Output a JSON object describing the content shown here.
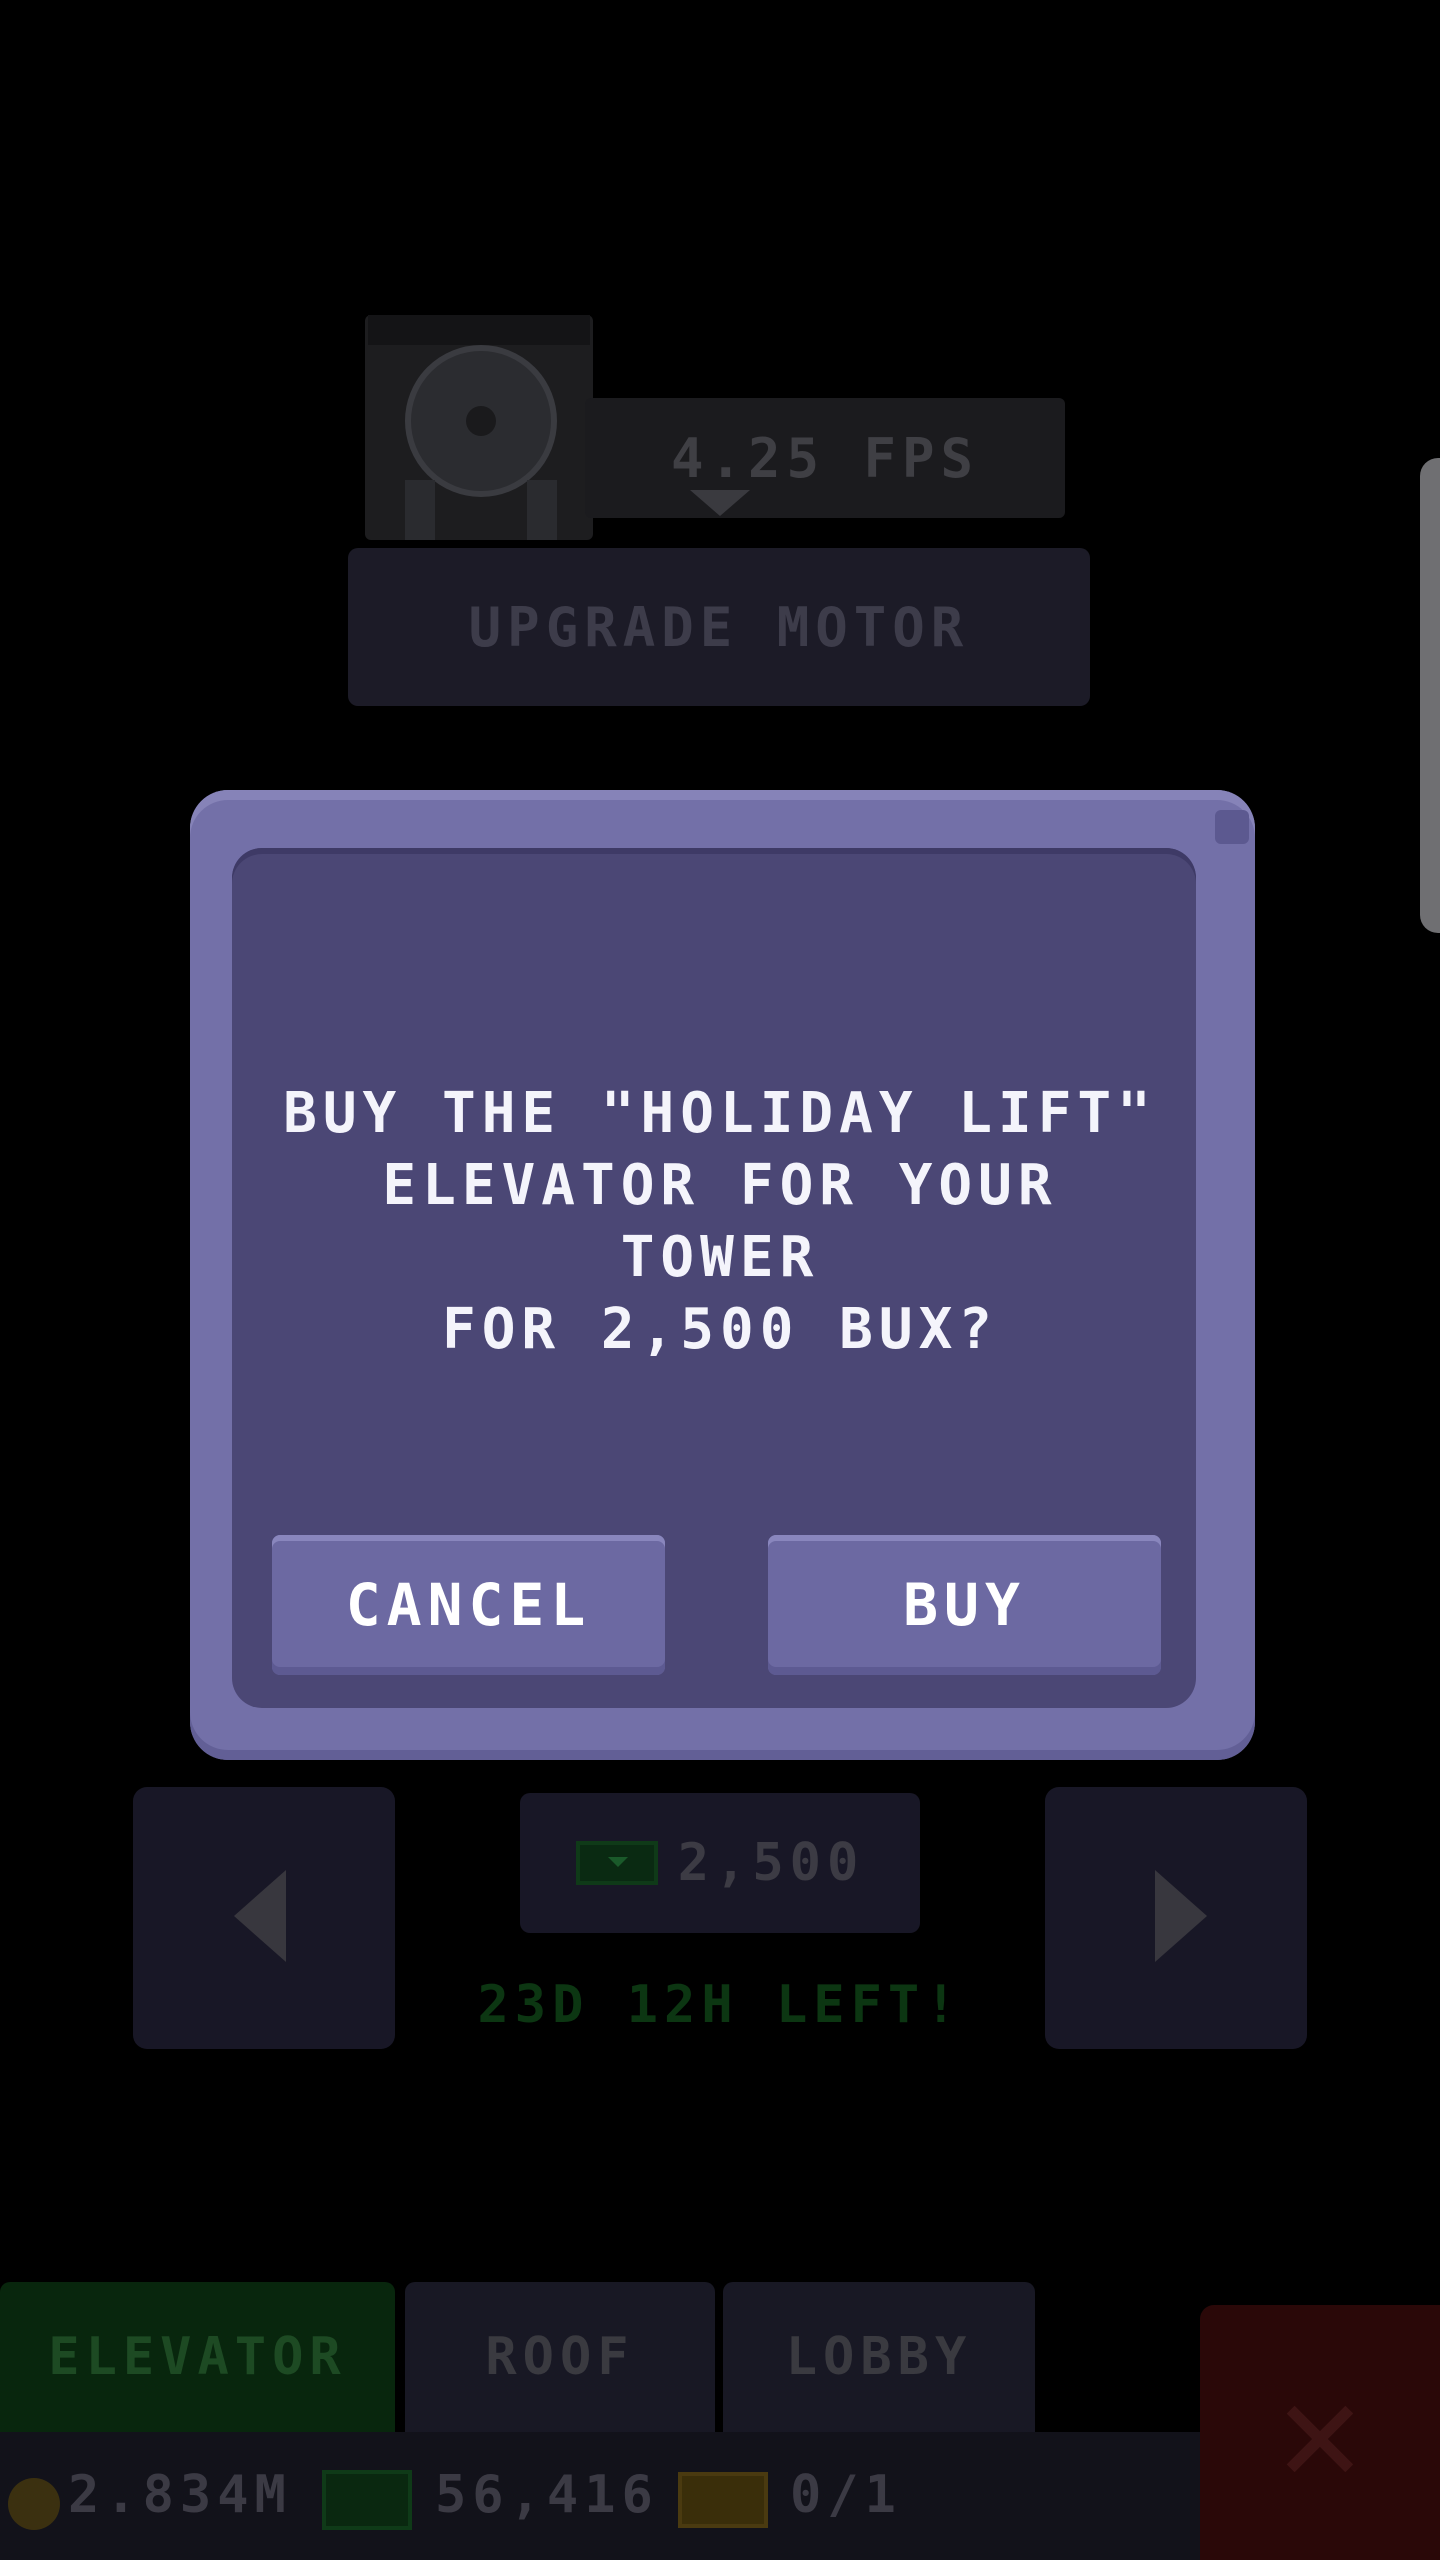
{
  "motor": {
    "speed_label": "4.25 FPS",
    "upgrade_label": "UPGRADE MOTOR"
  },
  "dialog": {
    "message_line1": "BUY THE \"HOLIDAY LIFT\"",
    "message_line2": "ELEVATOR FOR YOUR TOWER",
    "message_line3": "FOR 2,500 BUX?",
    "cancel_label": "CANCEL",
    "buy_label": "BUY"
  },
  "item": {
    "price": "2,500",
    "time_left": "23D 12H LEFT!"
  },
  "tabs": [
    {
      "label": "ELEVATOR",
      "active": true
    },
    {
      "label": "ROOF",
      "active": false
    },
    {
      "label": "LOBBY",
      "active": false
    }
  ],
  "status": {
    "coins": "2.834M",
    "bux": "56,416",
    "tickets": "0/1"
  },
  "icons": {
    "prev": "chevron-left-icon",
    "next": "chevron-right-icon",
    "close": "close-icon",
    "coin": "coin-icon",
    "bux": "bux-icon",
    "ticket": "ticket-icon"
  },
  "colors": {
    "dialog_bg": "#4b4775",
    "dialog_border": "#7370a8",
    "button": "#6c69a2",
    "active_tab": "#08260d",
    "close": "#2a0808"
  }
}
